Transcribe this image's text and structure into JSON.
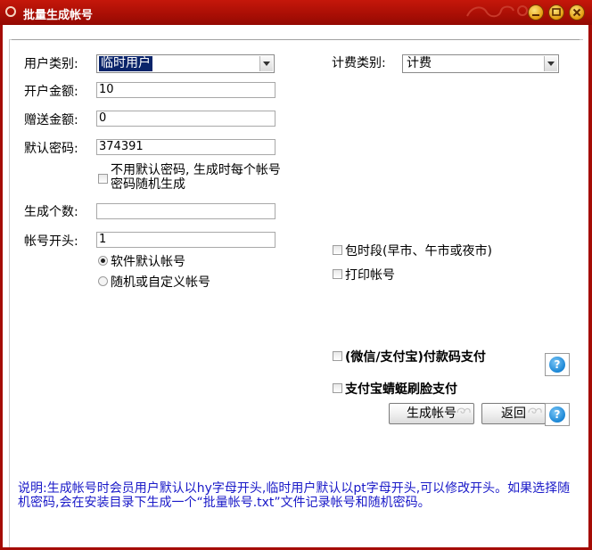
{
  "window": {
    "title": "批量生成帐号"
  },
  "form": {
    "user_type_label": "用户类别:",
    "user_type_value": "临时用户",
    "billing_type_label": "计费类别:",
    "billing_type_value": "计费",
    "open_amount_label": "开户金额:",
    "open_amount_value": "10",
    "gift_amount_label": "赠送金额:",
    "gift_amount_value": "0",
    "default_password_label": "默认密码:",
    "default_password_value": "374391",
    "random_password_checkbox_line1": "不用默认密码, 生成时每个帐号",
    "random_password_checkbox_line2": "密码随机生成",
    "random_password_checked": false,
    "count_label": "生成个数:",
    "count_value": "",
    "prefix_label": "帐号开头:",
    "prefix_value": "1",
    "radio_default_account": "软件默认帐号",
    "radio_random_account": "随机或自定义帐号",
    "selected_radio": "default"
  },
  "options": {
    "period_checkbox": "包时段(早市、午市或夜市)",
    "print_checkbox": "打印帐号",
    "qr_pay_checkbox": "(微信/支付宝)付款码支付",
    "face_pay_checkbox": "支付宝蜻蜓刷脸支付"
  },
  "buttons": {
    "generate": "生成帐号",
    "back": "返回",
    "help": "?"
  },
  "note": "说明:生成帐号时会员用户默认以hy字母开头,临时用户默认以pt字母开头,可以修改开头。如果选择随机密码,会在安装目录下生成一个“批量帐号.txt”文件记录帐号和随机密码。",
  "colors": {
    "title_bar": "#a80e05",
    "note_text": "#1919c8",
    "selection": "#0a246a"
  }
}
